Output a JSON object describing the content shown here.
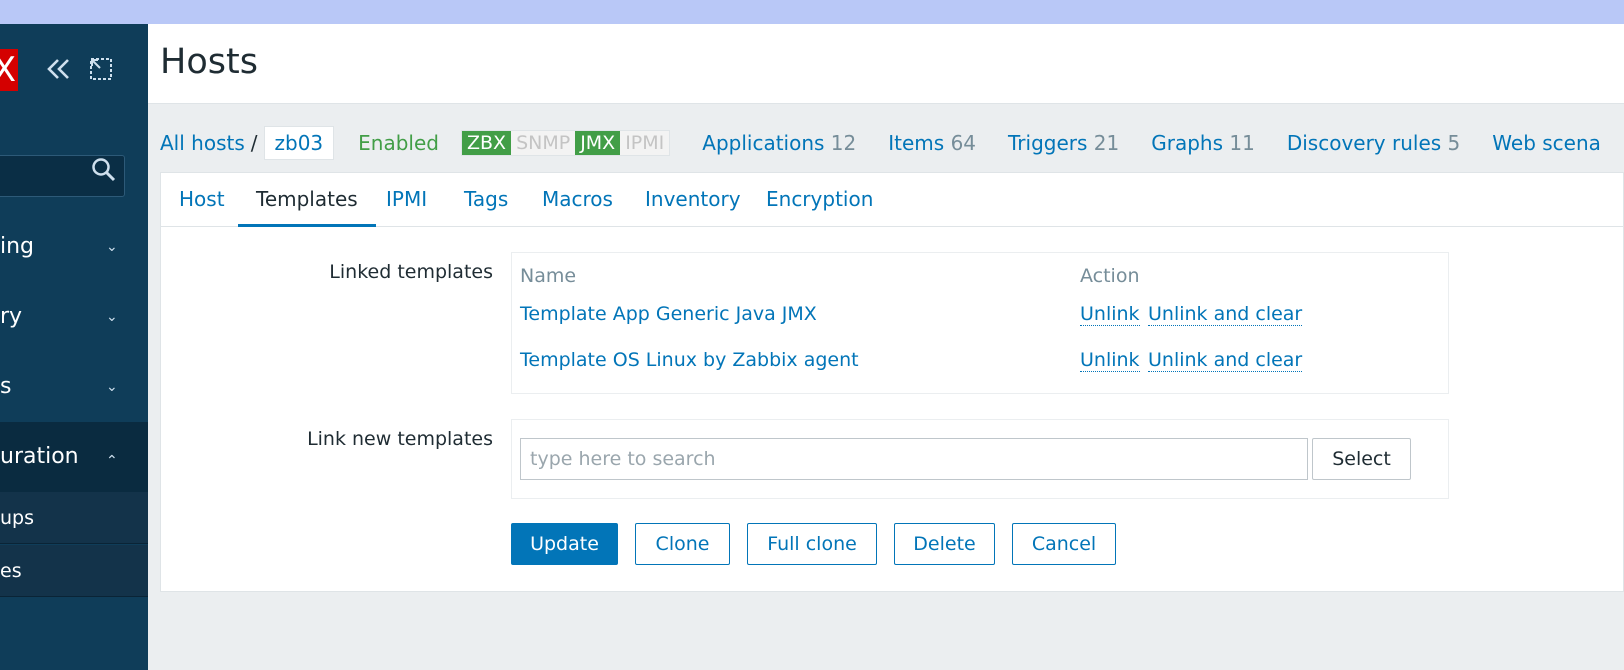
{
  "sidebar": {
    "logo_text": "X",
    "collapse_icon": "double-chevron-left-icon",
    "kiosk_icon": "fullscreen-icon",
    "search_icon": "search-icon",
    "items": [
      {
        "label": "ing",
        "expanded": false
      },
      {
        "label": "ry",
        "expanded": false
      },
      {
        "label": "s",
        "expanded": false
      },
      {
        "label": "uration",
        "expanded": true
      }
    ],
    "subitems": [
      {
        "label": "ups"
      },
      {
        "label": "es"
      }
    ]
  },
  "header": {
    "title": "Hosts"
  },
  "hostbar": {
    "all_hosts": "All hosts",
    "separator": "/",
    "host_name": "zb03",
    "status": "Enabled",
    "availability": [
      {
        "label": "ZBX",
        "state": "on"
      },
      {
        "label": "SNMP",
        "state": "off"
      },
      {
        "label": "JMX",
        "state": "on"
      },
      {
        "label": "IPMI",
        "state": "off"
      }
    ],
    "links": [
      {
        "label": "Applications",
        "count": "12"
      },
      {
        "label": "Items",
        "count": "64"
      },
      {
        "label": "Triggers",
        "count": "21"
      },
      {
        "label": "Graphs",
        "count": "11"
      },
      {
        "label": "Discovery rules",
        "count": "5"
      },
      {
        "label": "Web scena",
        "count": ""
      }
    ]
  },
  "tabs": [
    {
      "label": "Host",
      "active": false
    },
    {
      "label": "Templates",
      "active": true
    },
    {
      "label": "IPMI",
      "active": false
    },
    {
      "label": "Tags",
      "active": false
    },
    {
      "label": "Macros",
      "active": false
    },
    {
      "label": "Inventory",
      "active": false
    },
    {
      "label": "Encryption",
      "active": false
    }
  ],
  "linked_templates": {
    "label": "Linked templates",
    "columns": [
      "Name",
      "Action"
    ],
    "rows": [
      {
        "name": "Template App Generic Java JMX",
        "unlink": "Unlink",
        "unlink_clear": "Unlink and clear"
      },
      {
        "name": "Template OS Linux by Zabbix agent",
        "unlink": "Unlink",
        "unlink_clear": "Unlink and clear"
      }
    ]
  },
  "link_new": {
    "label": "Link new templates",
    "placeholder": "type here to search",
    "value": "",
    "select_label": "Select"
  },
  "buttons": {
    "update": "Update",
    "clone": "Clone",
    "full_clone": "Full clone",
    "delete": "Delete",
    "cancel": "Cancel"
  },
  "colors": {
    "accent": "#0275b8",
    "sidebar": "#0f3d59",
    "enabled": "#429e47",
    "logo": "#d40000",
    "top_band": "#b9c8f7"
  }
}
